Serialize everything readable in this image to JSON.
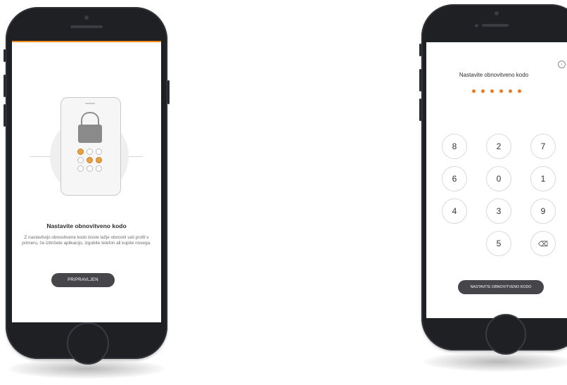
{
  "left_screen": {
    "title": "Nastavite obnovitveno kodo",
    "description": "Z nastavitvijo obnovitvene kodo boste lažje obnovili vaš profil v primeru, če izbrišete aplikacijo, izgubite telefon ali kupite novega.",
    "button_label": "PRIPRAVLJEN",
    "illustration": {
      "icon": "padlock-icon",
      "dots_filled": [
        true,
        false,
        false,
        false,
        true,
        true,
        false,
        false,
        false
      ]
    }
  },
  "right_screen": {
    "title": "Nastavite obnovitveno kodo",
    "info_icon_glyph": "i",
    "pin_entered_count": 6,
    "keypad": {
      "keys": [
        "8",
        "2",
        "7",
        "6",
        "0",
        "1",
        "4",
        "3",
        "9",
        "5"
      ],
      "backspace_glyph": "⌫"
    },
    "button_label": "NASTAVITE OBNOVITVENO KODO"
  },
  "colors": {
    "accent": "#ec7b1f",
    "button_bg": "#46464a",
    "phone_body": "#1f2024"
  }
}
